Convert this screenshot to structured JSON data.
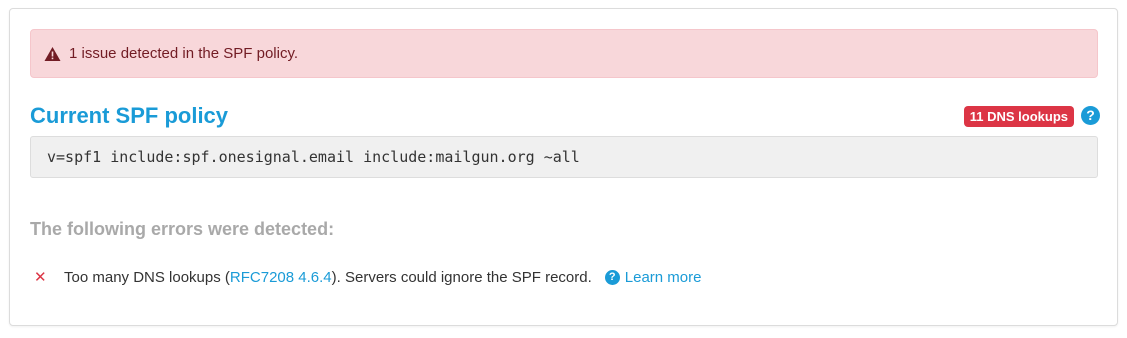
{
  "alert": {
    "icon": "warning-triangle-icon",
    "text": "1 issue detected in the SPF policy.",
    "color": "#721c24",
    "background": "#f8d7da"
  },
  "policy": {
    "title": "Current SPF policy",
    "lookups_badge": "11 DNS lookups",
    "help_glyph": "?",
    "record": "v=spf1 include:spf.onesignal.email include:mailgun.org ~all"
  },
  "errors": {
    "heading": "The following errors were detected:",
    "items": [
      {
        "icon": "error-x-icon",
        "icon_glyph": "✕",
        "text_before": "Too many DNS lookups (",
        "link_text": "RFC7208 4.6.4",
        "text_after": "). Servers could ignore the SPF record.",
        "learn_more_glyph": "?",
        "learn_more_label": "Learn more"
      }
    ]
  },
  "colors": {
    "accent": "#1a9bd7",
    "danger": "#dc3545",
    "muted_heading": "#a9a9a9"
  }
}
